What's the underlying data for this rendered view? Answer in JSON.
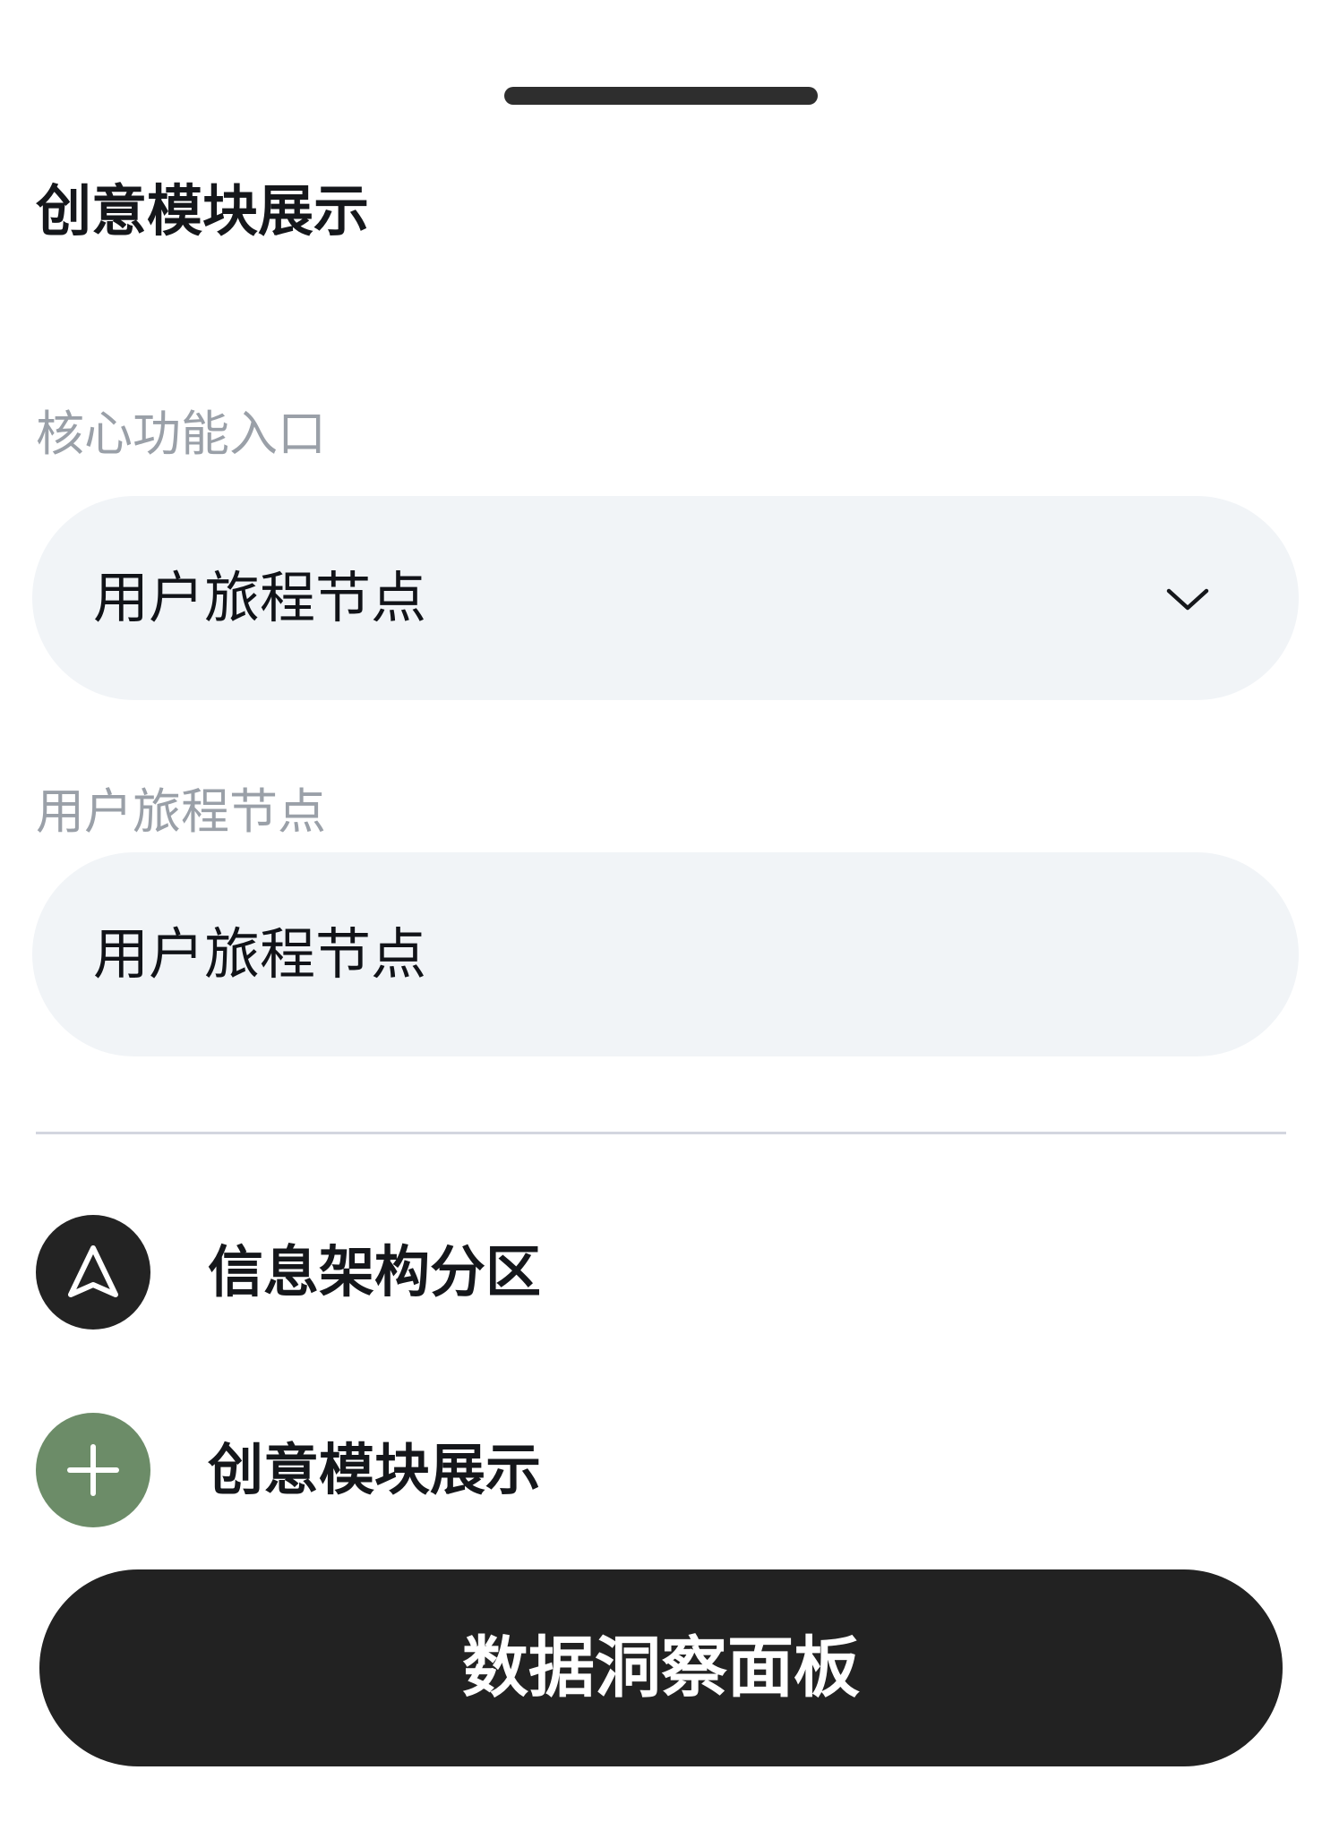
{
  "sheet": {
    "title": "创意模块展示"
  },
  "form": {
    "select_label": "核心功能入口",
    "select_value": "用户旅程节点",
    "input_label": "用户旅程节点",
    "input_value": "用户旅程节点"
  },
  "actions": [
    {
      "label": "信息架构分区",
      "icon": "navigation-arrow-icon",
      "icon_bg": "#232323"
    },
    {
      "label": "创意模块展示",
      "icon": "plus-icon",
      "icon_bg": "#6c8c68"
    }
  ],
  "primary_button": {
    "label": "数据洞察面板",
    "color": "#222222"
  },
  "colors": {
    "field_bg": "#f1f4f7",
    "label_gray": "#9aa0a8",
    "divider": "#d3d6df"
  }
}
